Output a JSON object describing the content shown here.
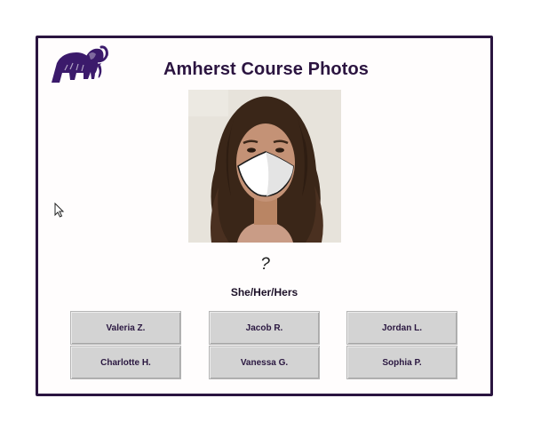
{
  "header": {
    "title": "Amherst Course Photos"
  },
  "card": {
    "name": "?",
    "pronouns": "She/Her/Hers"
  },
  "choices": [
    "Valeria Z.",
    "Jacob R.",
    "Jordan L.",
    "Charlotte H.",
    "Vanessa G.",
    "Sophia P."
  ],
  "colors": {
    "brand_purple": "#3b1a6b",
    "frame_border": "#2a1540",
    "button_bg": "#d3d3d3"
  },
  "icons": {
    "logo": "mammoth-logo-icon",
    "cursor": "mouse-cursor-icon"
  }
}
